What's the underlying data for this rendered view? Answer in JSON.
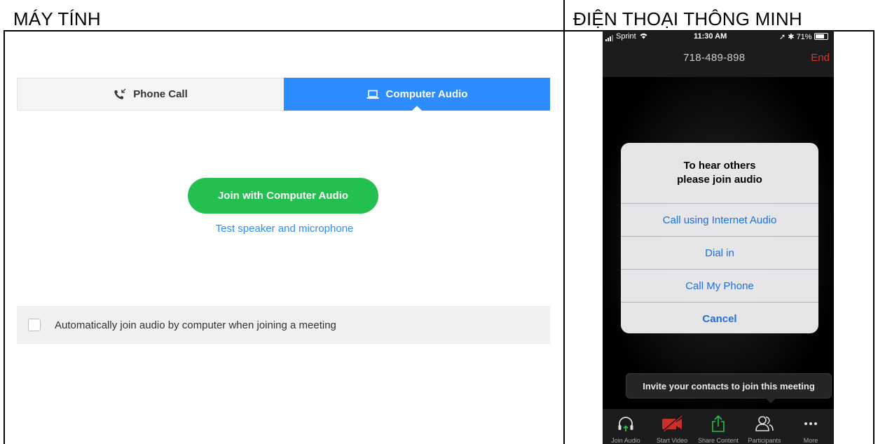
{
  "headers": {
    "left": "MÁY TÍNH",
    "right": "ĐIỆN THOẠI THÔNG MINH"
  },
  "desktop": {
    "tabs": [
      {
        "label": "Phone Call",
        "icon": "phone-icon",
        "active": false
      },
      {
        "label": "Computer Audio",
        "icon": "laptop-icon",
        "active": true
      }
    ],
    "join_button": "Join with Computer Audio",
    "test_link": "Test speaker and microphone",
    "auto_join_label": "Automatically join audio by computer when joining a meeting",
    "auto_join_checked": false
  },
  "phone": {
    "status": {
      "carrier": "Sprint",
      "time": "11:30 AM",
      "battery": "71%"
    },
    "number": "718-489-898",
    "end": "End",
    "alert": {
      "title_line1": "To hear others",
      "title_line2": "please join audio",
      "buttons": [
        "Call using Internet Audio",
        "Dial in",
        "Call My Phone",
        "Cancel"
      ]
    },
    "tooltip": "Invite your contacts to join this meeting",
    "toolbar": [
      {
        "label": "Join Audio",
        "icon": "headphones-icon"
      },
      {
        "label": "Start Video",
        "icon": "video-off-icon"
      },
      {
        "label": "Share Content",
        "icon": "share-icon"
      },
      {
        "label": "Participants",
        "icon": "participants-icon"
      },
      {
        "label": "More",
        "icon": "more-icon"
      }
    ]
  },
  "colors": {
    "zoom_blue": "#2d8cff",
    "join_green": "#23c04f",
    "ios_blue": "#1e6fe0",
    "end_red": "#d9342b"
  }
}
